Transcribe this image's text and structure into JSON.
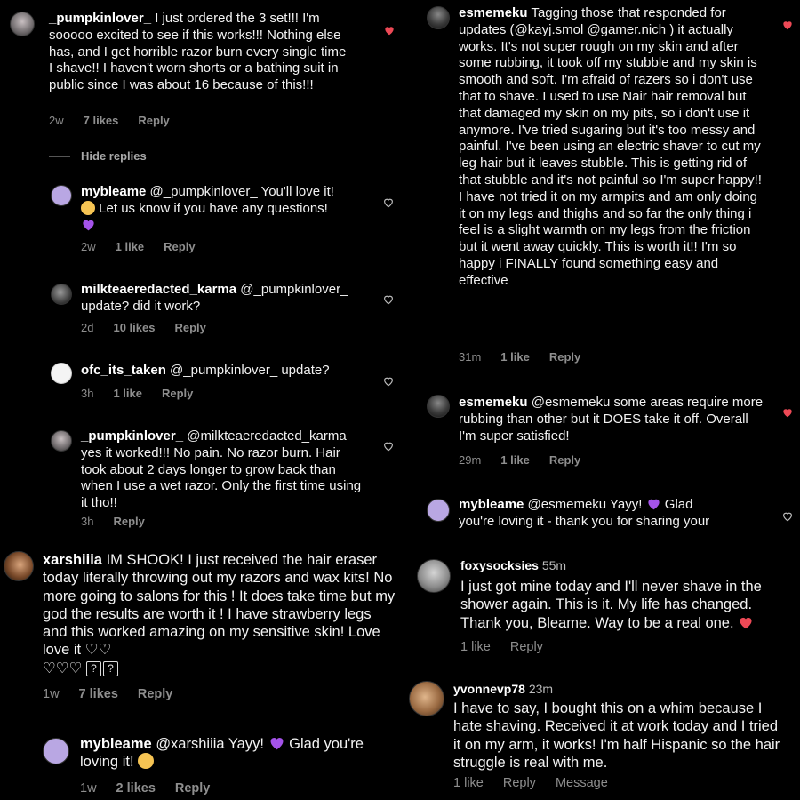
{
  "colors": {
    "heart_liked": "#ed4956",
    "purple_heart": "#a453e9",
    "muted": "#8e8e8e"
  },
  "panel1": {
    "c1": {
      "user": "_pumpkinlover_",
      "text": "I just ordered the 3 set!!! I'm sooooo excited to see if this works!!! Nothing else has, and I get horrible razor burn every single time I shave!! I haven't worn shorts or a bathing suit in public since I was about 16 because of this!!!",
      "time": "2w",
      "likes": "7 likes",
      "reply": "Reply"
    },
    "hide_replies": "Hide replies",
    "c2": {
      "user": "mybleame",
      "text1": "@_pumpkinlover_ You'll love it!",
      "text2": "Let us know if you have any questions!",
      "time": "2w",
      "likes": "1 like",
      "reply": "Reply"
    },
    "c3": {
      "user": "milkteaeredacted_karma",
      "text1": "@_pumpkinlover_",
      "text2": "update? did it work?",
      "time": "2d",
      "likes": "10 likes",
      "reply": "Reply"
    },
    "c4": {
      "user": "ofc_its_taken",
      "text": "@_pumpkinlover_ update?",
      "time": "3h",
      "likes": "1 like",
      "reply": "Reply"
    },
    "c5": {
      "user": "_pumpkinlover_",
      "text": "@milkteaeredacted_karma yes it worked!!! No pain. No razor burn. Hair took about 2 days longer to grow back than when I use a wet razor. Only the first time using it tho!!",
      "time": "3h",
      "reply": "Reply"
    }
  },
  "panel2": {
    "c1": {
      "user": "esmemeku",
      "text": "Tagging those that responded for updates (@kayj.smol @gamer.nich ) it actually works. It's not super rough on my skin and after some rubbing, it took off my stubble and my skin is smooth and soft. I'm afraid of razers so i don't use that to shave. I used to use Nair hair removal but that damaged my skin on my pits, so i don't use it anymore. I've tried sugaring but it's too messy and painful. I've been using an electric shaver to cut my leg hair but it leaves stubble. This is getting rid of that stubble and it's not painful so I'm super happy!! I have not tried it on my armpits and am only doing it on my legs and thighs and so far the only thing i feel is a slight warmth on my legs from the friction but it went away quickly. This is worth it!! I'm so happy i FINALLY found something easy and effective",
      "time": "31m",
      "likes": "1 like",
      "reply": "Reply"
    },
    "c2": {
      "user": "esmemeku",
      "text": "@esmemeku some areas require more rubbing than other but it DOES take it off. Overall I'm super satisfied!",
      "time": "29m",
      "likes": "1 like",
      "reply": "Reply"
    },
    "c3": {
      "user": "mybleame",
      "text1": "@esmemeku Yayy!",
      "text2": "Glad",
      "text3": "you're loving it - thank you for sharing your"
    }
  },
  "panel3": {
    "c1": {
      "user": "xarshiiia",
      "text1": "IM SHOOK! I just received the hair eraser today literally throwing out my razors and wax kits! No more going to salons for this ! It does take time but my god the results are worth it ! I have strawberry legs and this worked amazing on my sensitive skin! Love love it",
      "time": "1w",
      "likes": "7 likes",
      "reply": "Reply"
    },
    "c2": {
      "user": "mybleame",
      "text1": "@xarshiiia Yayy!",
      "text2": "Glad you're loving it!",
      "time": "1w",
      "likes": "2 likes",
      "reply": "Reply"
    }
  },
  "panel4": {
    "c1": {
      "user": "foxysocksies",
      "ago": "55m",
      "text": "I just got mine today and I'll never shave in the shower again. This is it. My life has changed. Thank you, Bleame. Way to be a real one.",
      "likes": "1 like",
      "reply": "Reply"
    },
    "c2": {
      "user": "yvonnevp78",
      "ago": "23m",
      "text": "I have to say, I bought this on a whim because I hate shaving. Received it at work today and I tried it on my arm, it works! I'm half Hispanic so the hair struggle is real with me.",
      "likes": "1 like",
      "reply": "Reply",
      "message": "Message"
    }
  }
}
